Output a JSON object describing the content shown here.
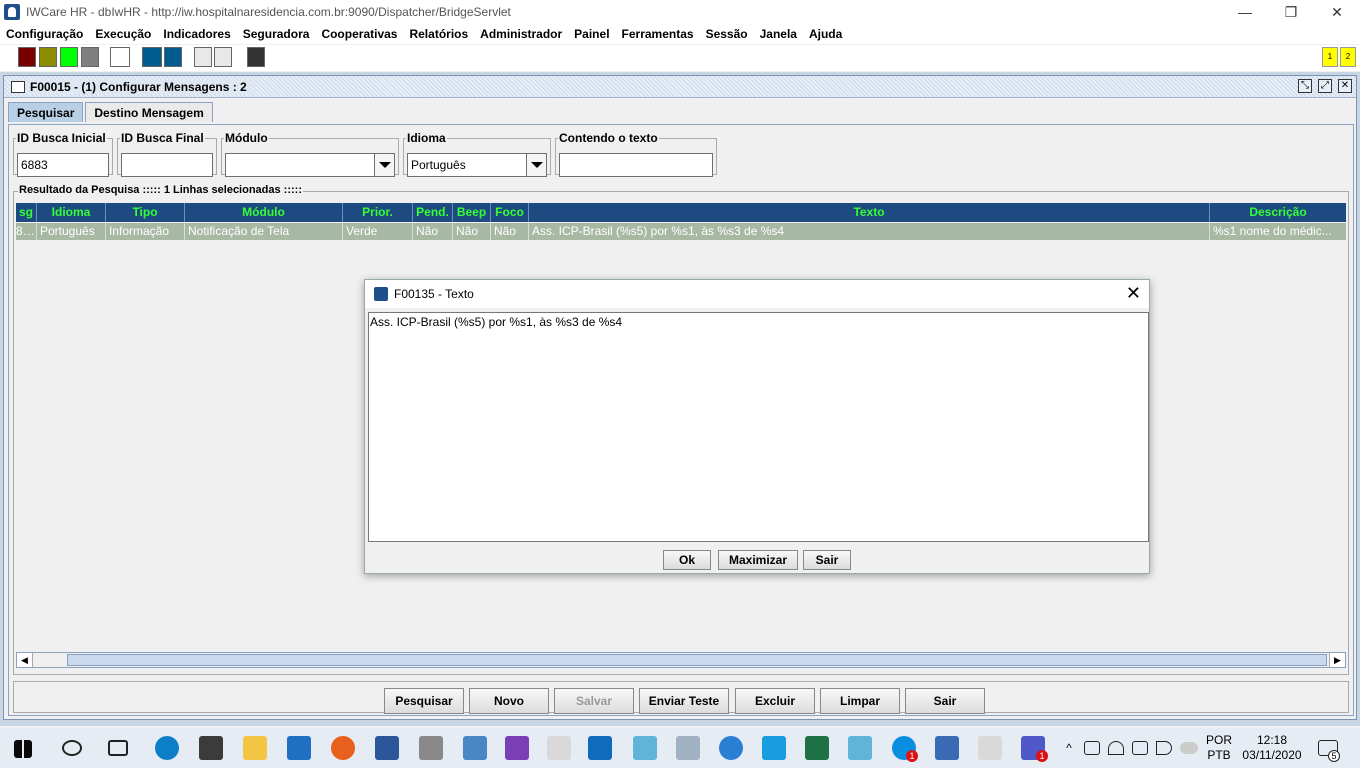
{
  "window": {
    "title": "IWCare HR - dbIwHR - http://iw.hospitalnaresidencia.com.br:9090/Dispatcher/BridgeServlet",
    "minimize": "—",
    "restore": "❐",
    "close": "✕"
  },
  "menu": [
    "Configuração",
    "Execução",
    "Indicadores",
    "Seguradora",
    "Cooperativas",
    "Relatórios",
    "Administrador",
    "Painel",
    "Ferramentas",
    "Sessão",
    "Janela",
    "Ajuda"
  ],
  "toolbar": {
    "colors": [
      "#7a0000",
      "#8c8c00",
      "#00ff00",
      "#7f7f7f",
      "#ffffff",
      "#005c8f",
      "#005c8f",
      "#333333"
    ],
    "badges": [
      "1",
      "2"
    ]
  },
  "frame": {
    "title": "F00015 - (1) Configurar Mensagens : 2",
    "tabs": [
      "Pesquisar",
      "Destino Mensagem"
    ]
  },
  "filters": {
    "id_inicial_label": "ID Busca Inicial",
    "id_inicial_value": "6883",
    "id_final_label": "ID Busca Final",
    "id_final_value": "",
    "modulo_label": "Módulo",
    "modulo_value": "",
    "idioma_label": "Idioma",
    "idioma_value": "Português",
    "contendo_label": "Contendo o texto",
    "contendo_value": ""
  },
  "results": {
    "label": "Resultado da Pesquisa ::::: 1 Linhas selecionadas :::::",
    "columns": [
      "sg",
      "Idioma",
      "Tipo",
      "Módulo",
      "Prior.",
      "Pend.",
      "Beep",
      "Foco",
      "Texto",
      "Descrição"
    ],
    "rows": [
      [
        "883",
        "Português",
        "Informação",
        "Notificação de Tela",
        "Verde",
        "Não",
        "Não",
        "Não",
        "Ass. ICP-Brasil (%s5) por %s1, às %s3 de %s4",
        "%s1 nome do médic..."
      ]
    ]
  },
  "buttons": {
    "pesquisar": "Pesquisar",
    "novo": "Novo",
    "salvar": "Salvar",
    "enviar_teste": "Enviar Teste",
    "excluir": "Excluir",
    "limpar": "Limpar",
    "sair": "Sair"
  },
  "dialog": {
    "title": "F00135 - Texto",
    "text": "Ass. ICP-Brasil (%s5) por %s1, às %s3 de %s4",
    "ok": "Ok",
    "maximizar": "Maximizar",
    "sair": "Sair"
  },
  "taskbar": {
    "lang_1": "POR",
    "lang_2": "PTB",
    "time": "12:18",
    "date": "03/11/2020",
    "notifications": "5",
    "badge_skype": "1",
    "badge_teams": "1"
  }
}
